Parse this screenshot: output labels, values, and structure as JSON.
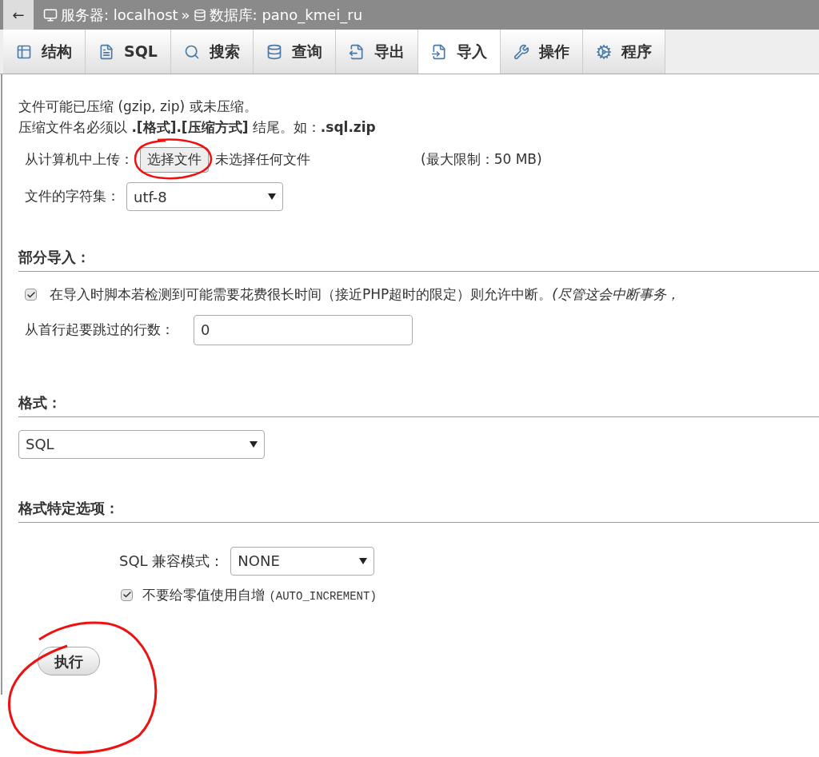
{
  "breadcrumb": {
    "back": "←",
    "server_label": "服务器: localhost",
    "separator": "»",
    "database_label": "数据库: pano_kmei_ru"
  },
  "tabs": [
    {
      "label": "结构",
      "selected": false
    },
    {
      "label": "SQL",
      "selected": false
    },
    {
      "label": "搜索",
      "selected": false
    },
    {
      "label": "查询",
      "selected": false
    },
    {
      "label": "导出",
      "selected": false
    },
    {
      "label": "导入",
      "selected": true
    },
    {
      "label": "操作",
      "selected": false
    },
    {
      "label": "程序",
      "selected": false
    }
  ],
  "file_section": {
    "note_1": "文件可能已压缩 (gzip, zip) 或未压缩。",
    "note_2": "压缩文件名必须以 **.[格式].[压缩方式]** 结尾。如：**.sql.zip**",
    "upload_label": "从计算机中上传：",
    "choose_button": "选择文件",
    "no_file_text": "未选择任何文件",
    "max_limit": "(最大限制：50 MB)",
    "charset_label": "文件的字符集：",
    "charset_value": "utf-8"
  },
  "partial_import": {
    "heading": "部分导入：",
    "allow_interrupt": {
      "checked": true,
      "text": "在导入时脚本若检测到可能需要花费很长时间（接近PHP超时的限定）则允许中断。",
      "note": "(尽管这会中断事务，"
    },
    "skip_label": "从首行起要跳过的行数：",
    "skip_value": "0"
  },
  "format": {
    "heading": "格式：",
    "value": "SQL"
  },
  "format_options": {
    "heading": "格式特定选项：",
    "compat_label": "SQL 兼容模式：",
    "compat_value": "NONE",
    "no_auto_value": {
      "checked": true,
      "text": "不要给零值使用自增",
      "code": "(AUTO_INCREMENT)"
    }
  },
  "submit_button": "执行"
}
